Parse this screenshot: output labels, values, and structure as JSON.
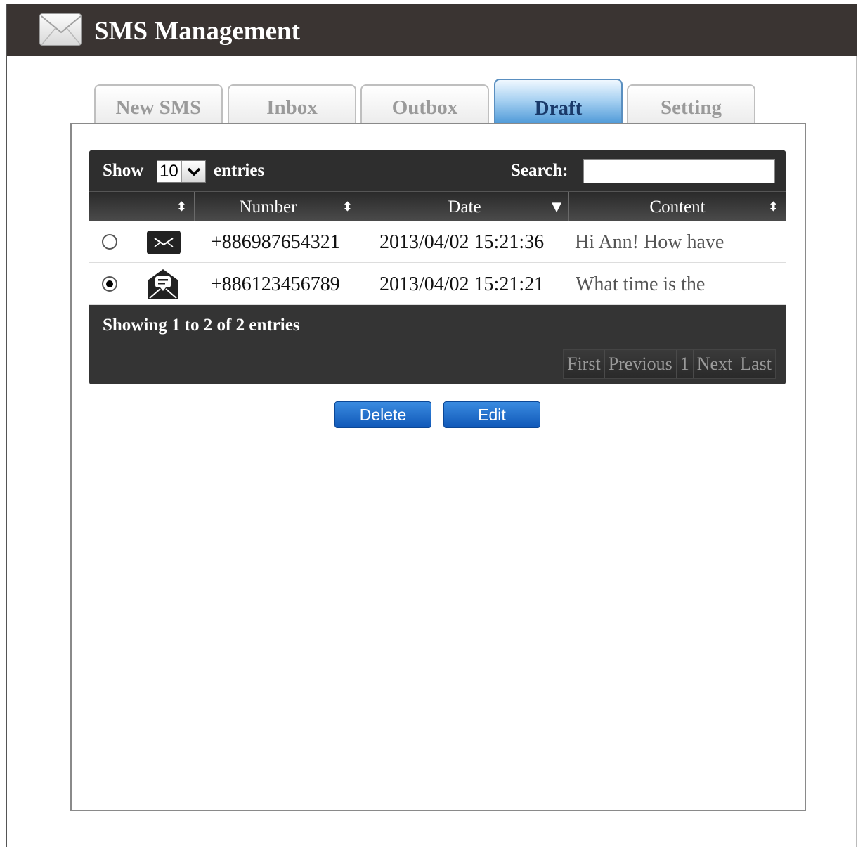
{
  "header": {
    "title": "SMS Management",
    "icon": "envelope-icon"
  },
  "tabs": [
    {
      "label": "New SMS",
      "active": false
    },
    {
      "label": "Inbox",
      "active": false
    },
    {
      "label": "Outbox",
      "active": false
    },
    {
      "label": "Draft",
      "active": true
    },
    {
      "label": "Setting",
      "active": false
    }
  ],
  "table": {
    "show_label": "Show",
    "entries_label": "entries",
    "length_value": "10",
    "search_label": "Search:",
    "search_value": "",
    "columns": [
      "",
      "",
      "Number",
      "Date",
      "Content"
    ],
    "rows": [
      {
        "selected": false,
        "icon": "envelope-closed-icon",
        "number": "+886987654321",
        "date": "2013/04/02 15:21:36",
        "content": "Hi Ann! How have"
      },
      {
        "selected": true,
        "icon": "envelope-open-message-icon",
        "number": "+886123456789",
        "date": "2013/04/02 15:21:21",
        "content": "What time is the"
      }
    ],
    "info": "Showing 1 to 2 of 2 entries",
    "pager": [
      "First",
      "Previous",
      "1",
      "Next",
      "Last"
    ]
  },
  "buttons": {
    "delete": "Delete",
    "edit": "Edit"
  },
  "colors": {
    "header_bg": "#3a3432",
    "table_dark": "#2e2e2e",
    "active_tab": "#4f9ad8",
    "button_blue": "#1a6fd0"
  }
}
